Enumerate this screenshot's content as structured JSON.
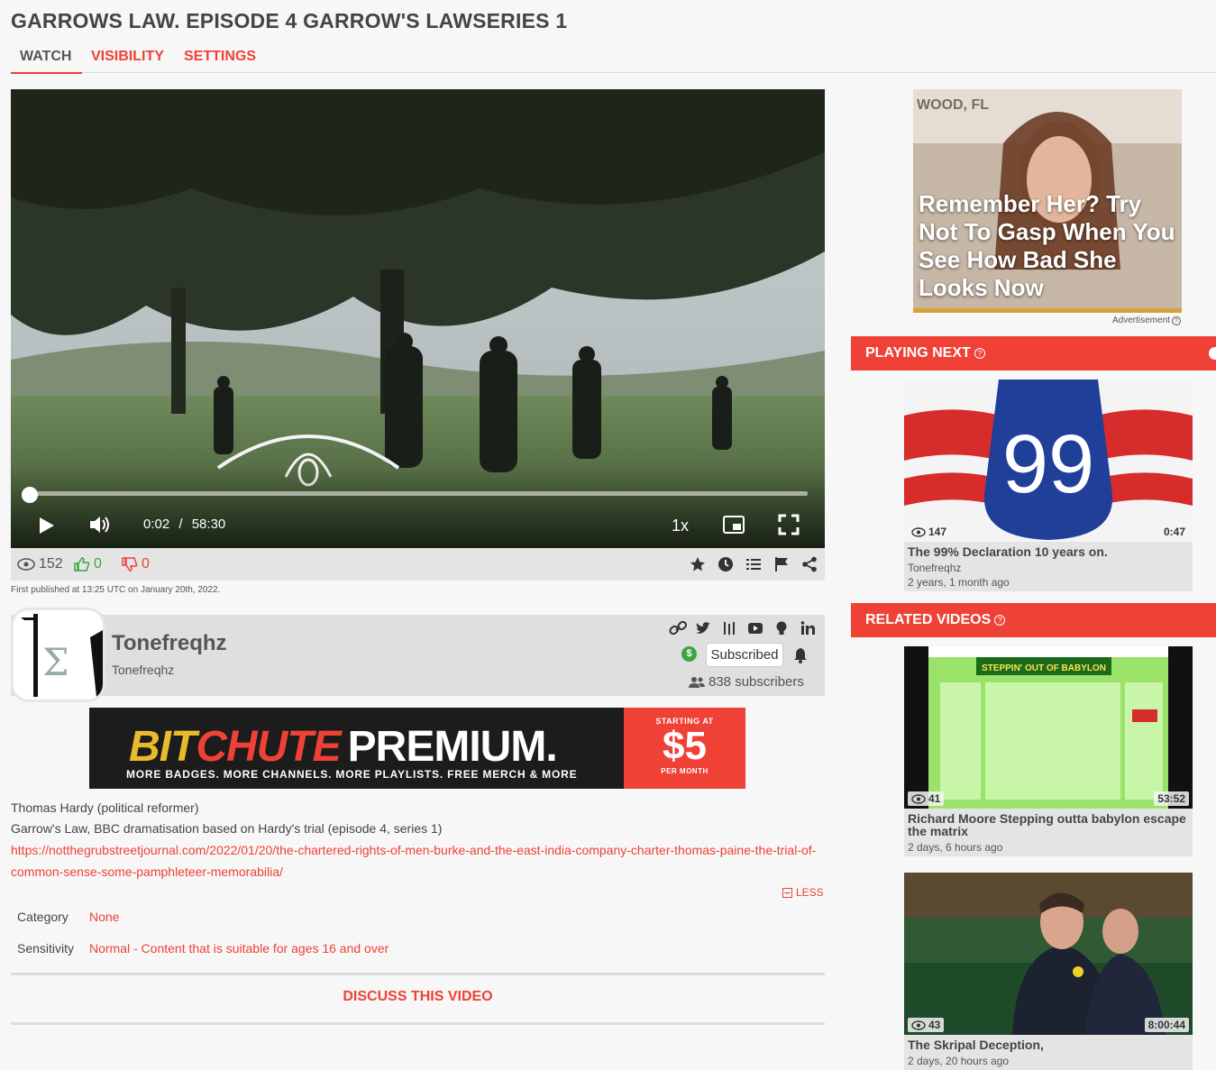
{
  "page": {
    "title": "GARROWS LAW. EPISODE 4 GARROW'S LAWSERIES 1"
  },
  "tabs": [
    {
      "label": "WATCH"
    },
    {
      "label": "VISIBILITY"
    },
    {
      "label": "SETTINGS"
    }
  ],
  "player": {
    "current_time": "0:02",
    "separator": "/",
    "duration": "58:30",
    "speed": "1x",
    "progress_fraction": 0.0006
  },
  "stats": {
    "views": "152",
    "likes": "0",
    "dislikes": "0"
  },
  "first_published": "First published at 13:25 UTC on January 20th, 2022.",
  "channel": {
    "name": "Tonefreqhz",
    "owner": "Tonefreqhz",
    "subscribe_label": "Subscribed",
    "subscribers": "838 subscribers"
  },
  "premium_banner": {
    "bit": "BIT",
    "chute": "CHUTE",
    "premium": "PREMIUM.",
    "tagline": "MORE BADGES. MORE CHANNELS. MORE PLAYLISTS. FREE MERCH & MORE",
    "starting_at": "STARTING AT",
    "price": "$5",
    "per_month": "PER MONTH"
  },
  "description": {
    "line1": "Thomas Hardy (political reformer)",
    "line2": "Garrow's Law, BBC dramatisation based on Hardy's trial (episode 4, series 1)",
    "link": "https://notthegrubstreetjournal.com/2022/01/20/the-chartered-rights-of-men-burke-and-the-east-india-company-charter-thomas-paine-the-trial-of-common-sense-some-pamphleteer-memorabilia/",
    "less_label": "LESS"
  },
  "meta": {
    "category_label": "Category",
    "category_value": "None",
    "sensitivity_label": "Sensitivity",
    "sensitivity_value": "Normal - Content that is suitable for ages 16 and over"
  },
  "discuss_label": "DISCUSS THIS VIDEO",
  "ad": {
    "headline": "Remember Her? Try Not To Gasp When You See How Bad She Looks Now",
    "label": "Advertisement"
  },
  "playing_next": {
    "heading": "PLAYING NEXT",
    "video": {
      "title": "The 99% Declaration 10 years on.",
      "channel": "Tonefreqhz",
      "ago": "2 years, 1 month ago",
      "views": "147",
      "duration": "0:47",
      "thumb_text": "99"
    }
  },
  "related": {
    "heading": "RELATED VIDEOS",
    "videos": [
      {
        "title": "Richard Moore Stepping outta babylon escape the matrix",
        "ago": "2 days, 6 hours ago",
        "views": "41",
        "duration": "53:52",
        "thumb_text": "STEPPIN' OUT OF BABYLON"
      },
      {
        "title": "The Skripal Deception,",
        "ago": "2 days, 20 hours ago",
        "views": "43",
        "duration": "8:00:44"
      }
    ]
  },
  "colors": {
    "accent": "#ef4136",
    "like": "#3fa33f",
    "stats_bg": "#e4e4e4"
  }
}
